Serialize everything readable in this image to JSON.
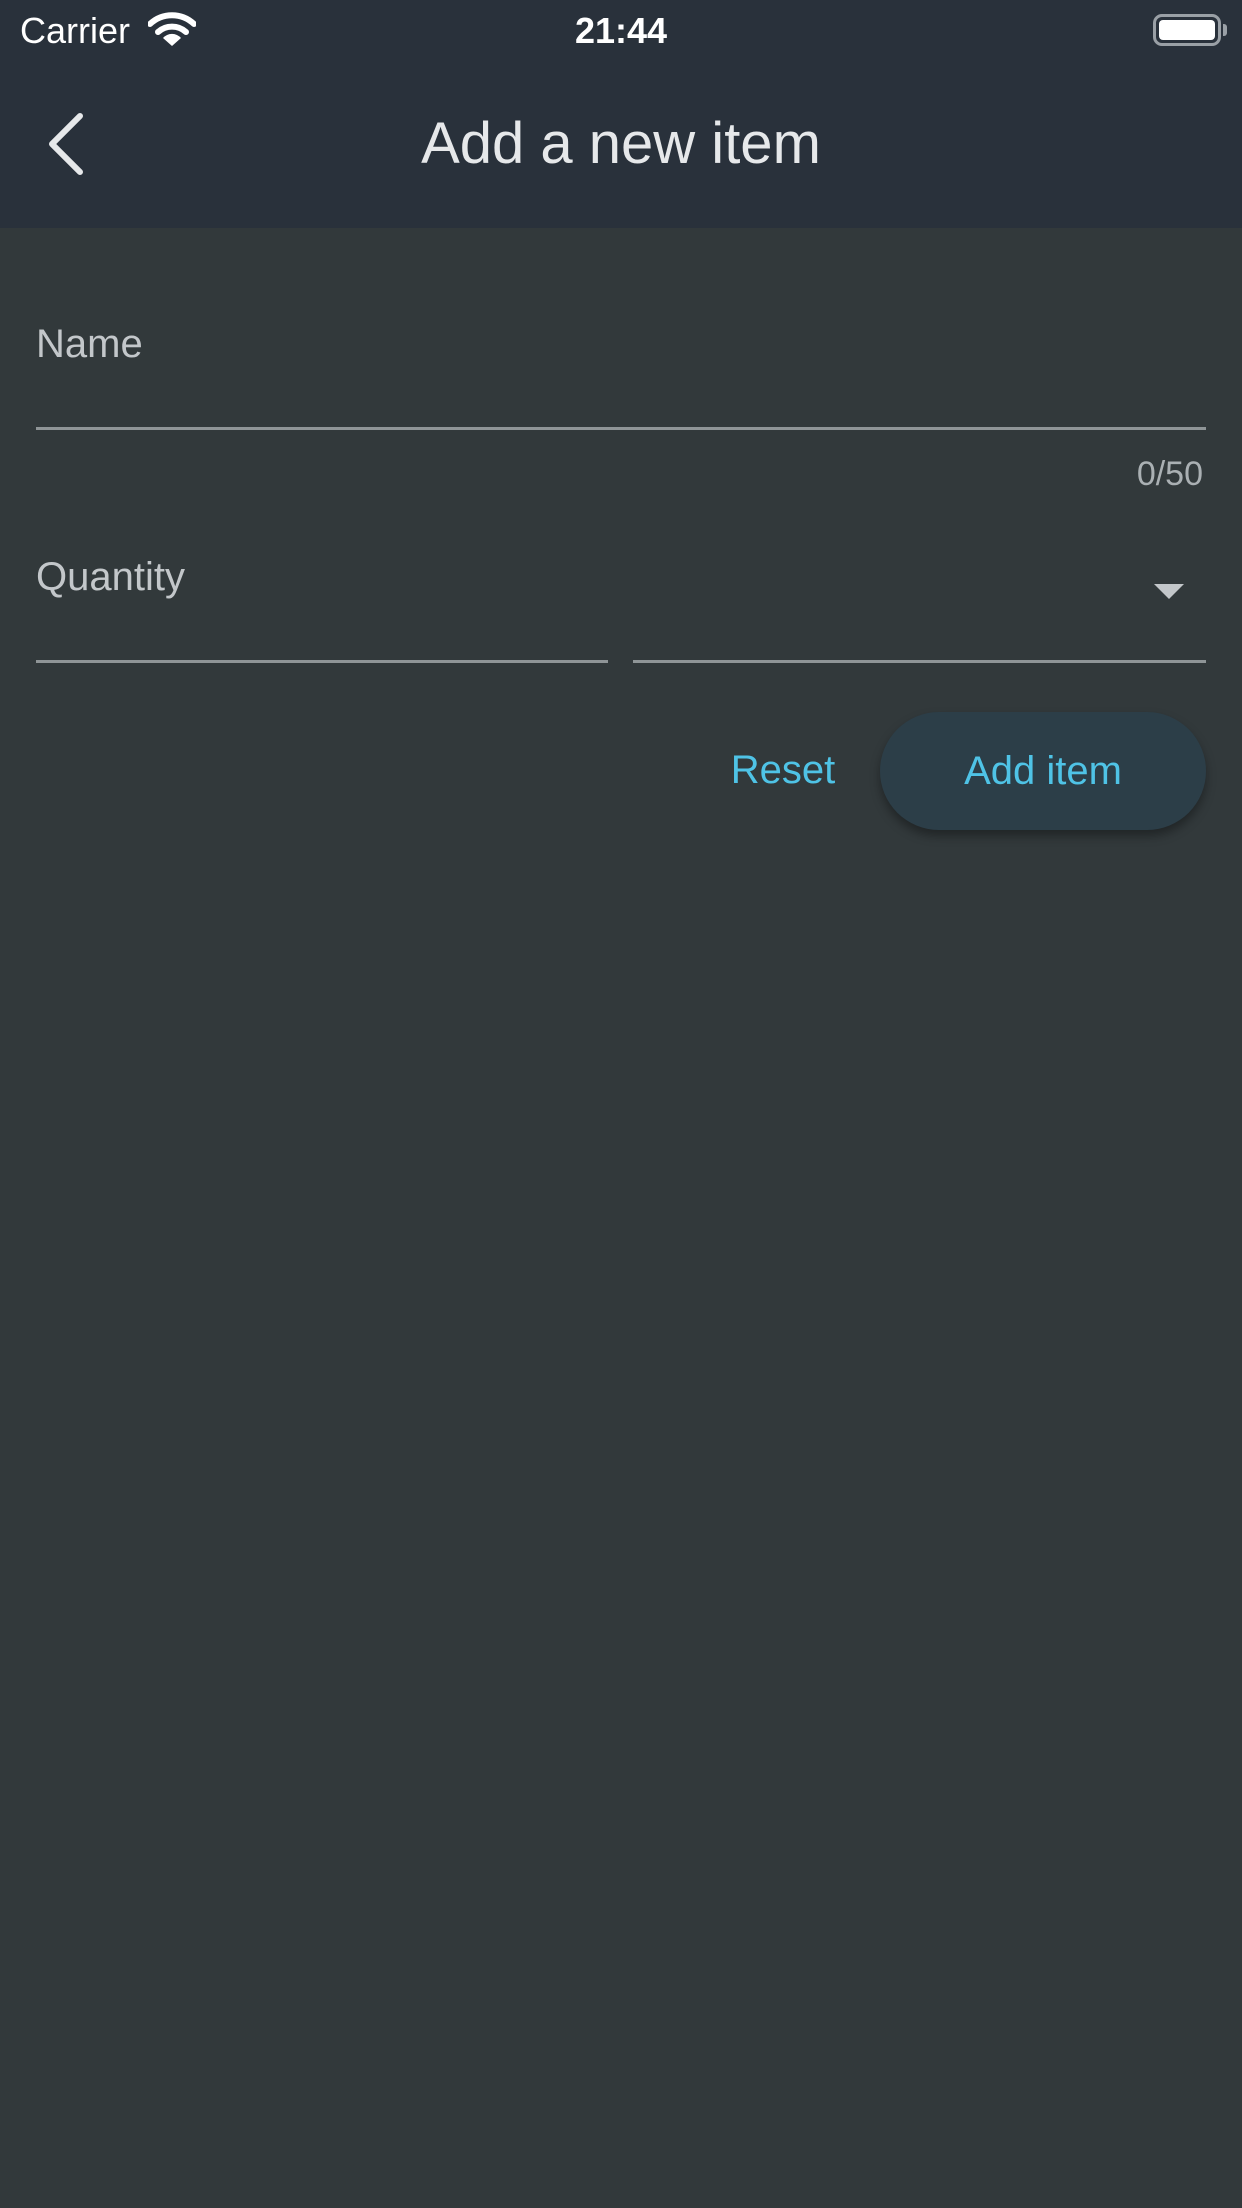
{
  "status_bar": {
    "carrier": "Carrier",
    "time": "21:44",
    "wifi_icon": "wifi-icon",
    "battery_icon": "battery-icon"
  },
  "app_bar": {
    "title": "Add a new item",
    "back_icon": "chevron-left-icon"
  },
  "form": {
    "name": {
      "label": "Name",
      "value": "",
      "counter": "0/50"
    },
    "quantity": {
      "label": "Quantity",
      "value": ""
    },
    "unit_dropdown": {
      "selected": "",
      "icon": "dropdown-arrow-icon"
    },
    "reset_label": "Reset",
    "submit_label": "Add item"
  },
  "colors": {
    "background": "#32393b",
    "app_bar": "#29313b",
    "accent": "#4fc3e6",
    "button_bg": "#2c3e48"
  }
}
